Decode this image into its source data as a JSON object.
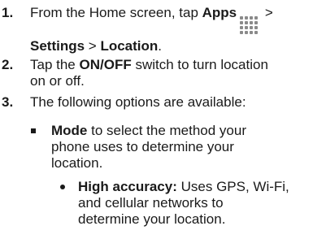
{
  "steps": [
    {
      "number": "1.",
      "line1_prefix": "From the Home screen, tap ",
      "apps_label": "Apps",
      "apps_icon": "apps-grid-icon",
      "sep1": " >",
      "settings_label": "Settings",
      "sep2": " > ",
      "location_label": "Location",
      "end": "."
    },
    {
      "number": "2.",
      "prefix": "Tap the ",
      "switch_label": "ON/OFF",
      "line1_suffix": " switch to turn location",
      "line2": "on or off."
    },
    {
      "number": "3.",
      "text": "The following options are available:"
    }
  ],
  "options": {
    "mode": {
      "label": "Mode",
      "line1_suffix": " to select the method your",
      "line2": "phone uses to determine your",
      "line3": "location."
    },
    "high_accuracy": {
      "label": "High accuracy:",
      "line1_suffix": " Uses GPS, Wi-Fi,",
      "line2": "and cellular networks to",
      "line3": "determine your location."
    }
  }
}
